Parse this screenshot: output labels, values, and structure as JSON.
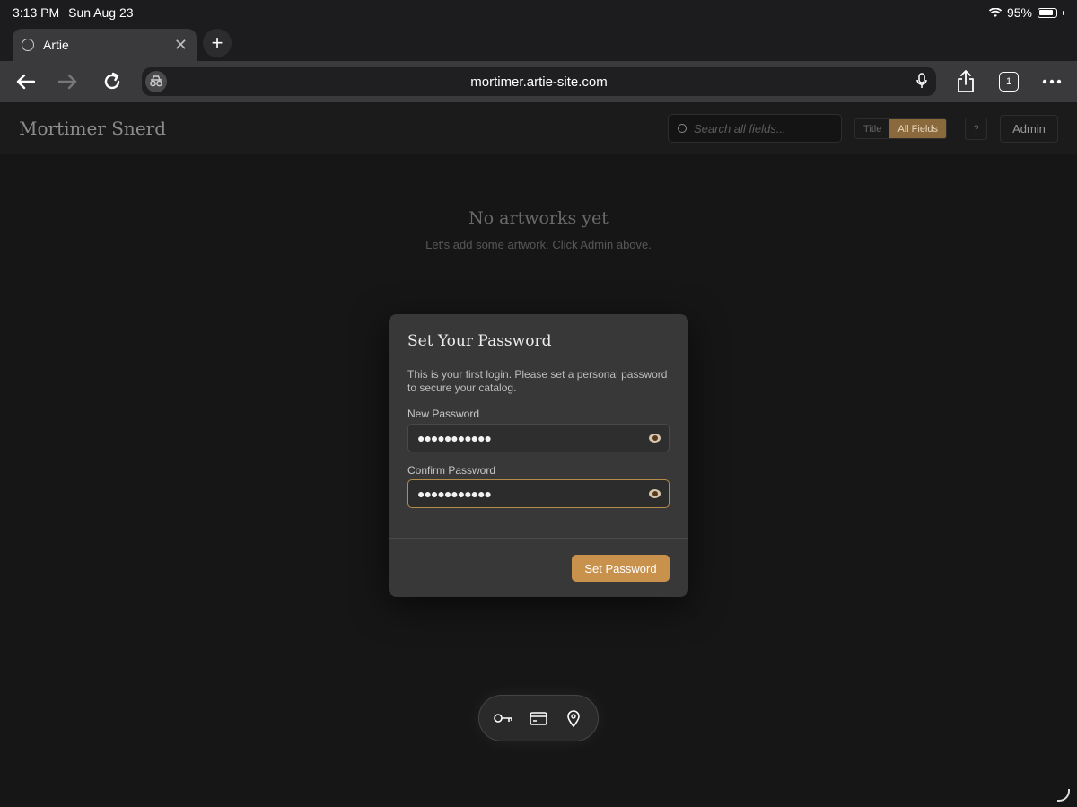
{
  "status": {
    "time": "3:13 PM",
    "date": "Sun Aug 23",
    "battery": "95%"
  },
  "tab": {
    "title": "Artie"
  },
  "browser": {
    "url": "mortimer.artie-site.com",
    "tab_count": "1"
  },
  "header": {
    "brand": "Mortimer Snerd",
    "search_placeholder": "Search all fields...",
    "toggle": [
      "Title",
      "All Fields"
    ],
    "help": "?",
    "admin": "Admin"
  },
  "empty": {
    "title": "No artworks yet",
    "subtitle": "Let's add some artwork. Click Admin above."
  },
  "modal": {
    "title": "Set Your Password",
    "description": "This is your first login. Please set a personal password to secure your catalog.",
    "new_label": "New Password",
    "new_value": "●●●●●●●●●●●",
    "confirm_label": "Confirm Password",
    "confirm_value": "●●●●●●●●●●●",
    "submit": "Set Password"
  },
  "colors": {
    "accent": "#c8924d",
    "toggle_active": "#8a6a3c"
  }
}
